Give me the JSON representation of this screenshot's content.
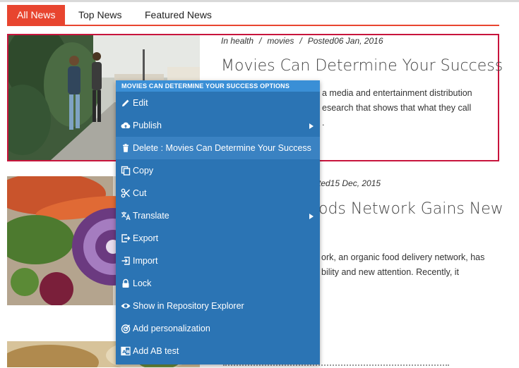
{
  "tabs": [
    {
      "label": "All News",
      "active": true
    },
    {
      "label": "Top News",
      "active": false
    },
    {
      "label": "Featured News",
      "active": false
    }
  ],
  "articles": [
    {
      "category": "In health",
      "tag": "movies",
      "posted": "Posted06 Jan, 2016",
      "title": "Movies Can Determine Your Success",
      "excerpt_lines": [
        "a media and entertainment distribution",
        "esearch that shows that what they call",
        "."
      ]
    },
    {
      "posted": "ted15 Dec, 2015",
      "title": "ods Network Gains New",
      "excerpt_lines": [
        "ork, an organic food delivery network, has",
        "bility and new attention. Recently, it"
      ]
    }
  ],
  "context_menu": {
    "header": "MOVIES CAN DETERMINE YOUR SUCCESS OPTIONS",
    "items": [
      {
        "label": "Edit",
        "icon": "pencil-icon"
      },
      {
        "label": "Publish",
        "icon": "cloud-upload-icon",
        "submenu": true
      },
      {
        "label": "Delete : Movies Can Determine Your Success",
        "icon": "trash-icon",
        "highlighted": true
      },
      {
        "label": "Copy",
        "icon": "copy-icon"
      },
      {
        "label": "Cut",
        "icon": "scissors-icon"
      },
      {
        "label": "Translate",
        "icon": "translate-icon",
        "submenu": true
      },
      {
        "label": "Export",
        "icon": "export-icon"
      },
      {
        "label": "Import",
        "icon": "import-icon"
      },
      {
        "label": "Lock",
        "icon": "lock-icon"
      },
      {
        "label": "Show in Repository Explorer",
        "icon": "eye-icon"
      },
      {
        "label": "Add personalization",
        "icon": "target-icon"
      },
      {
        "label": "Add AB test",
        "icon": "ab-test-icon"
      }
    ]
  },
  "colors": {
    "accent": "#e8452f",
    "selection_border": "#c8143c",
    "menu_bg": "#2b74b4",
    "menu_header_bg": "#3a8fd6"
  }
}
